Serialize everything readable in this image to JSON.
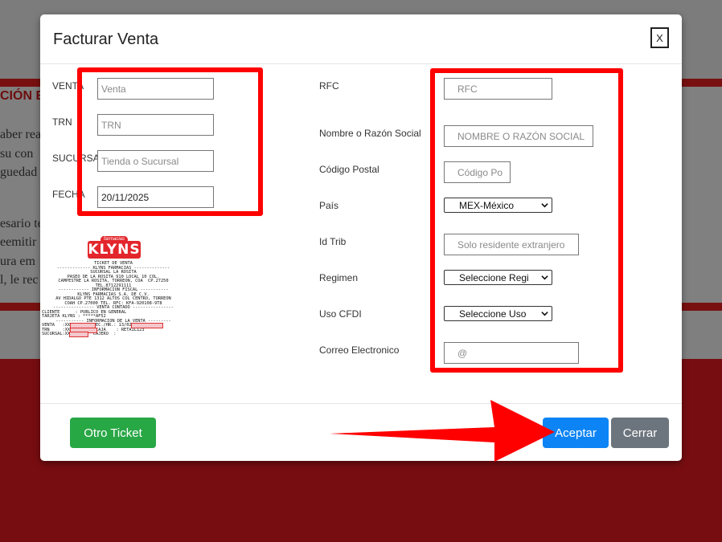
{
  "background": {
    "heading": "CIÓN E",
    "lines": [
      "aber rea",
      "su con",
      "guedad",
      "esario te",
      "eemitir",
      "ura em",
      "l, le rec"
    ]
  },
  "modal": {
    "title": "Facturar Venta",
    "close_label": "X",
    "left_fields": [
      {
        "label": "VENTA",
        "placeholder": "Venta",
        "value": ""
      },
      {
        "label": "TRN",
        "placeholder": "TRN",
        "value": ""
      },
      {
        "label": "SUCURSAL",
        "placeholder": "Tienda o Sucursal",
        "value": ""
      },
      {
        "label": "FECHA",
        "placeholder": "",
        "value": "20/11/2025"
      }
    ],
    "right_fields": {
      "rfc": {
        "label": "RFC",
        "placeholder": "RFC"
      },
      "nombre": {
        "label": "Nombre o Razón Social",
        "placeholder": "NOMBRE O RAZÓN SOCIAL"
      },
      "cp": {
        "label": "Código Postal",
        "placeholder": "Código Po"
      },
      "pais": {
        "label": "País",
        "selected": "MEX-México"
      },
      "idtrib": {
        "label": "Id Trib",
        "placeholder": "Solo residente extranjero"
      },
      "regimen": {
        "label": "Regimen",
        "selected": "Seleccione Regi"
      },
      "usocfdi": {
        "label": "Uso CFDI",
        "selected": "Seleccione Uso"
      },
      "correo": {
        "label": "Correo Electronico",
        "placeholder": "@"
      }
    },
    "buttons": {
      "otro_ticket": "Otro Ticket",
      "aceptar": "Aceptar",
      "cerrar": "Cerrar"
    }
  },
  "ticket": {
    "logo_small": "farmacias",
    "logo_main": "KLYNS",
    "lines": [
      "TICKET DE VENTA",
      "------------- KLYNS FARMACIAS --------------",
      "SUCURSAL LA ROSITA",
      "PASEO DE LA ROSITA 910 LOCAL 10 COL.",
      "CAMPESTRE LA ROSITA, TORREON, COA  CP.27250",
      "TEL.8712291111",
      "------------ INFORMACION FISCAL -----------",
      "KLYNS FARMACIAS S.A. DE C.V.",
      "AV HIDALGO PTE 1312 ALTOS COL CENTRO, TORREON",
      "COAH CP.27000 TEL. RFC: KFA-920108-9T8",
      "---------------- VENTA CONTADO ----------------",
      "CLIENTE      : PUBLICO EN GENERAL",
      "TARJETA KLYNS : *****AF52",
      "----------- INFORMACION DE LA VENTA ---------",
      "VENTA   :XXXXXXX    FEC./HR.: 13/02/2023 11:41",
      "TRN     :XXXXXXXXX   CAJA    : RETAIL123",
      "SUCURSAL:XXXXX      CAJERO  :"
    ]
  },
  "colors": {
    "highlight_red": "#ff0000",
    "primary": "#0d84f5",
    "success": "#28a745",
    "secondary": "#6c757d",
    "page_red": "#780d11"
  }
}
